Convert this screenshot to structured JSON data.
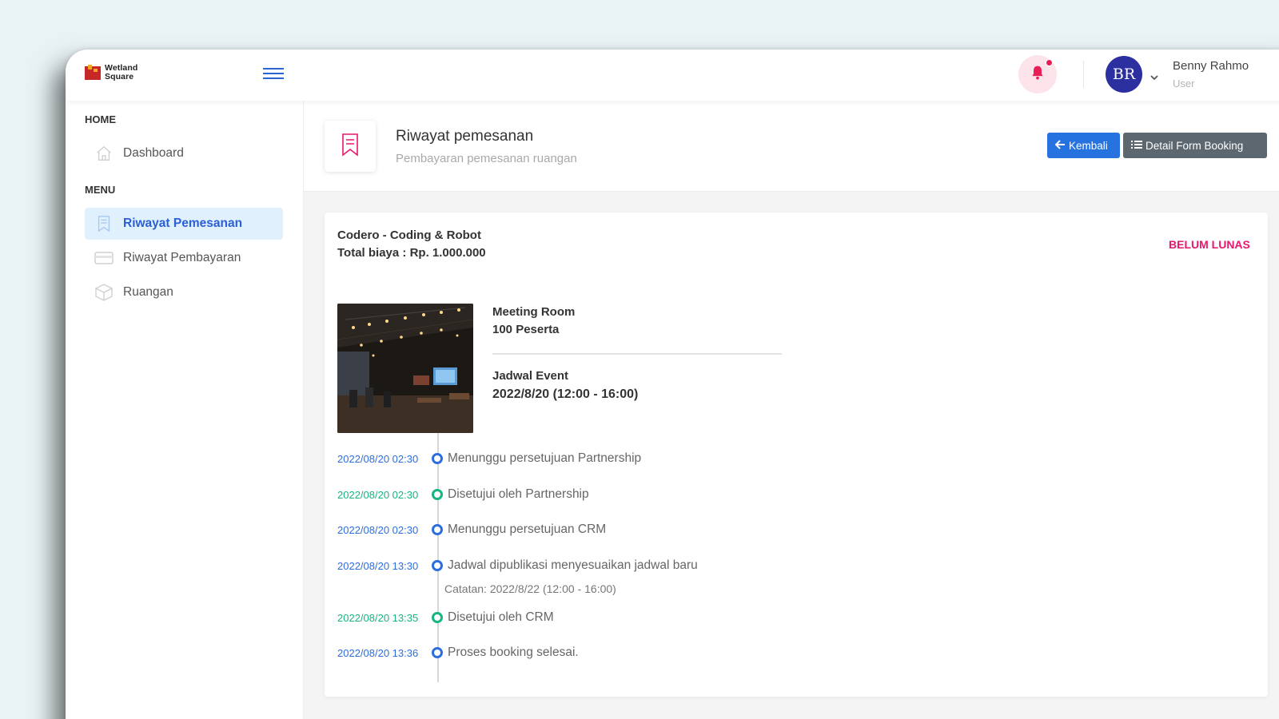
{
  "brand": {
    "name_line1": "Wetland",
    "name_line2": "Square",
    "logo_color": "#c62828"
  },
  "topbar": {
    "user_initials": "BR",
    "user_name": "Benny Rahmo",
    "user_role": "User",
    "notification_dot_color": "#e91e56"
  },
  "sidebar": {
    "home_heading": "HOME",
    "menu_heading": "MENU",
    "items": [
      {
        "label": "Dashboard",
        "icon": "home-icon"
      },
      {
        "label": "Riwayat Pemesanan",
        "icon": "bookmark-icon",
        "active": true
      },
      {
        "label": "Riwayat Pembayaran",
        "icon": "credit-card-icon"
      },
      {
        "label": "Ruangan",
        "icon": "box-icon"
      }
    ]
  },
  "header": {
    "title": "Riwayat pemesanan",
    "subtitle": "Pembayaran pemesanan ruangan",
    "back_button": "Kembali",
    "detail_button": "Detail Form Booking"
  },
  "booking": {
    "event_name": "Codero - Coding & Robot",
    "total_cost": "Total biaya : Rp. 1.000.000",
    "status": "BELUM LUNAS",
    "room_type": "Meeting Room",
    "capacity": "100 Peserta",
    "schedule_label": "Jadwal Event",
    "schedule_value": "2022/8/20 (12:00 - 16:00)"
  },
  "timeline": [
    {
      "date": "2022/08/20 02:30",
      "text": "Menunggu persetujuan Partnership",
      "color": "blue"
    },
    {
      "date": "2022/08/20 02:30",
      "text": "Disetujui oleh Partnership",
      "color": "green"
    },
    {
      "date": "2022/08/20 02:30",
      "text": "Menunggu persetujuan CRM",
      "color": "blue"
    },
    {
      "date": "2022/08/20 13:30",
      "text": "Jadwal dipublikasi menyesuaikan jadwal baru",
      "color": "blue"
    },
    {
      "date": "2022/08/20 13:35",
      "text": "Disetujui oleh CRM",
      "color": "green"
    },
    {
      "date": "2022/08/20 13:36",
      "text": "Proses booking selesai.",
      "color": "blue"
    }
  ],
  "timeline_note": "Catatan: 2022/8/22 (12:00 - 16:00)",
  "colors": {
    "primary": "#2673e0",
    "secondary": "#5c6770",
    "danger": "#e9176b",
    "success": "#16b67d"
  }
}
